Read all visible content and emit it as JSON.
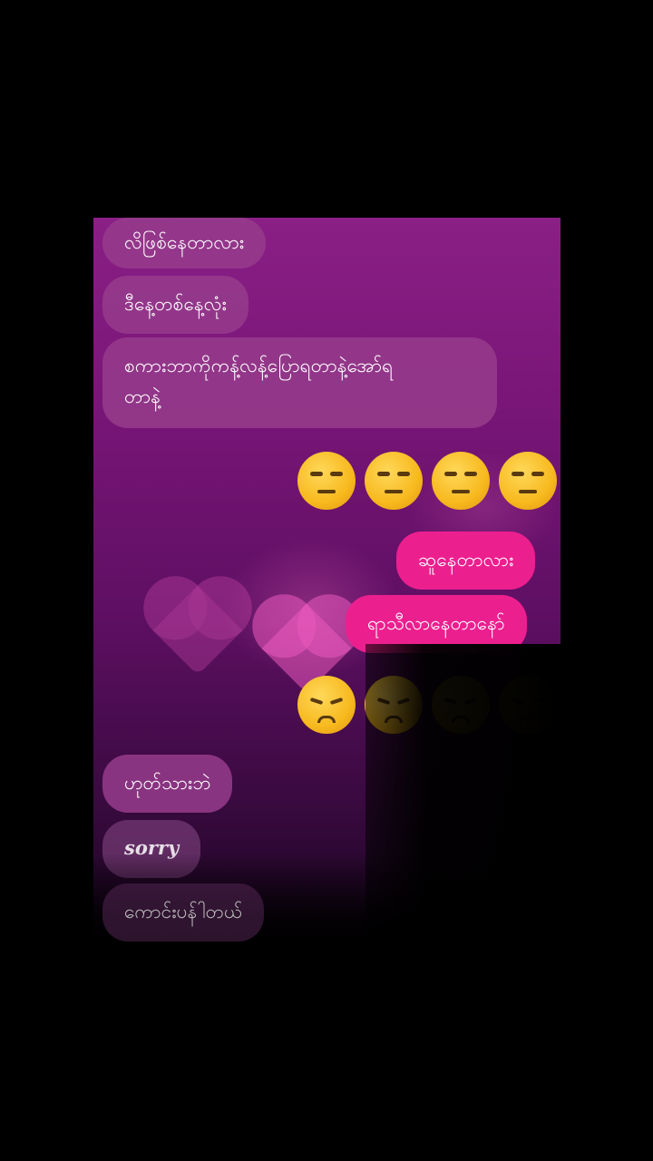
{
  "messages": {
    "m1": "လိဖြစ်နေတာလား",
    "m2": "ဒီနေ့တစ်နေ့လုံး",
    "m3_line1": "စကားဘာကိုကန့်လန့်ပြောရတာနဲ့အော်ရ",
    "m3_line2": "တာနဲ့",
    "m4": "ဆူနေတာလား",
    "m5": "ရာသီလာနေတာနော်",
    "m6": "ဟုတ်သားဘဲ",
    "m7": "sorry",
    "m8": "ကောင်းပန်ါတယ်"
  },
  "emojis": {
    "row1": [
      "unamused-face-icon",
      "unamused-face-icon",
      "unamused-face-icon",
      "unamused-face-icon"
    ],
    "row2": [
      "disappointed-face-icon",
      "disappointed-face-icon",
      "disappointed-face-icon",
      "disappointed-face-icon"
    ]
  },
  "colors": {
    "sent_bubble": "#ec1f8f",
    "received_bubble": "#963c8c",
    "background_top": "#8a1f86"
  }
}
